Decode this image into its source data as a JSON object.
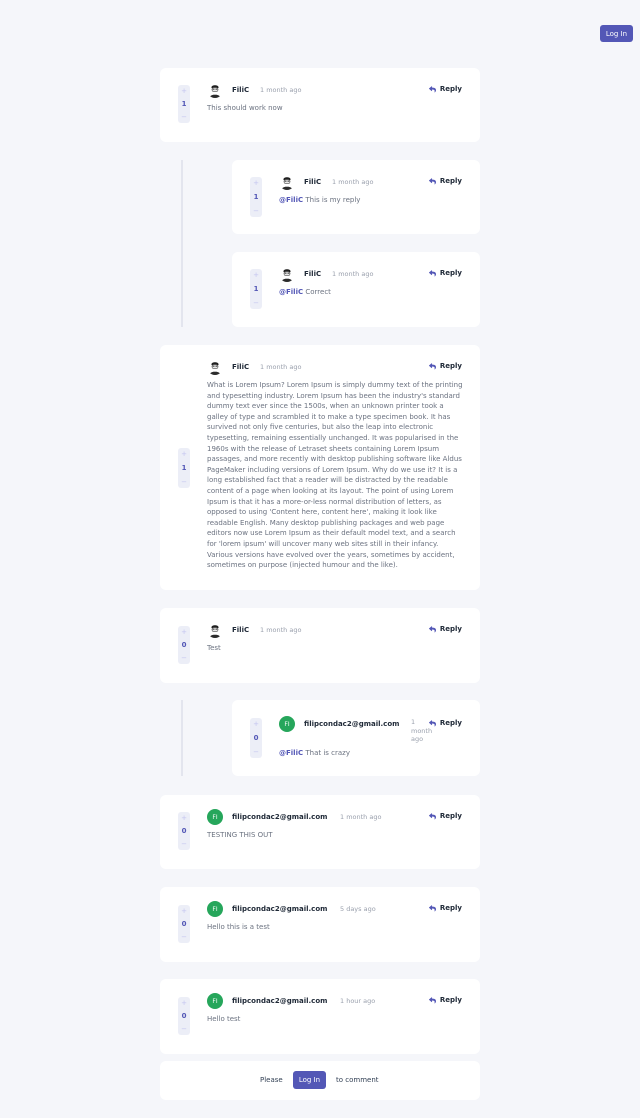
{
  "header": {
    "login_label": "Log In"
  },
  "comments": [
    {
      "user": "FiliC",
      "avatar": "photo",
      "time": "1 month ago",
      "score": "1",
      "mention": "",
      "text": "This should work now",
      "reply_label": "Reply"
    },
    {
      "user": "FiliC",
      "avatar": "photo",
      "time": "1 month ago",
      "score": "1",
      "mention": "@FiliC",
      "text": "This is my reply",
      "reply_label": "Reply"
    },
    {
      "user": "FiliC",
      "avatar": "photo",
      "time": "1 month ago",
      "score": "1",
      "mention": "@FiliC",
      "text": "Correct",
      "reply_label": "Reply"
    },
    {
      "user": "FiliC",
      "avatar": "photo",
      "time": "1 month ago",
      "score": "1",
      "mention": "",
      "text": "What is Lorem Ipsum? Lorem Ipsum is simply dummy text of the printing and typesetting industry. Lorem Ipsum has been the industry's standard dummy text ever since the 1500s, when an unknown printer took a galley of type and scrambled it to make a type specimen book. It has survived not only five centuries, but also the leap into electronic typesetting, remaining essentially unchanged. It was popularised in the 1960s with the release of Letraset sheets containing Lorem Ipsum passages, and more recently with desktop publishing software like Aldus PageMaker including versions of Lorem Ipsum. Why do we use it? It is a long established fact that a reader will be distracted by the readable content of a page when looking at its layout. The point of using Lorem Ipsum is that it has a more-or-less normal distribution of letters, as opposed to using 'Content here, content here', making it look like readable English. Many desktop publishing packages and web page editors now use Lorem Ipsum as their default model text, and a search for 'lorem ipsum' will uncover many web sites still in their infancy. Various versions have evolved over the years, sometimes by accident, sometimes on purpose (injected humour and the like).",
      "reply_label": "Reply"
    },
    {
      "user": "FiliC",
      "avatar": "photo",
      "time": "1 month ago",
      "score": "0",
      "mention": "",
      "text": "Test",
      "reply_label": "Reply"
    },
    {
      "user": "filipcondac2@gmail.com",
      "avatar": "initials",
      "initials": "FI",
      "time_line1": "1",
      "time_line2": "month",
      "time_line3": "ago",
      "score": "0",
      "mention": "@FiliC",
      "text": "That is crazy",
      "reply_label": "Reply"
    },
    {
      "user": "filipcondac2@gmail.com",
      "avatar": "initials",
      "initials": "FI",
      "time": "1 month ago",
      "score": "0",
      "mention": "",
      "text": "TESTING THIS OUT",
      "reply_label": "Reply"
    },
    {
      "user": "filipcondac2@gmail.com",
      "avatar": "initials",
      "initials": "FI",
      "time": "5 days ago",
      "score": "0",
      "mention": "",
      "text": "Hello this is a test",
      "reply_label": "Reply"
    },
    {
      "user": "filipcondac2@gmail.com",
      "avatar": "initials",
      "initials": "FI",
      "time": "1 hour ago",
      "score": "0",
      "mention": "",
      "text": "Hello test",
      "reply_label": "Reply"
    }
  ],
  "vote": {
    "plus": "+",
    "minus": "−"
  },
  "footer": {
    "please": "Please",
    "login_label": "Log In",
    "to_comment": "to comment"
  },
  "colors": {
    "accent": "#5357b6",
    "background": "#f5f6fa",
    "initials_avatar": "#26a65b"
  },
  "icons": {
    "reply": "reply-arrow-icon",
    "avatar": "user-avatar-icon"
  }
}
